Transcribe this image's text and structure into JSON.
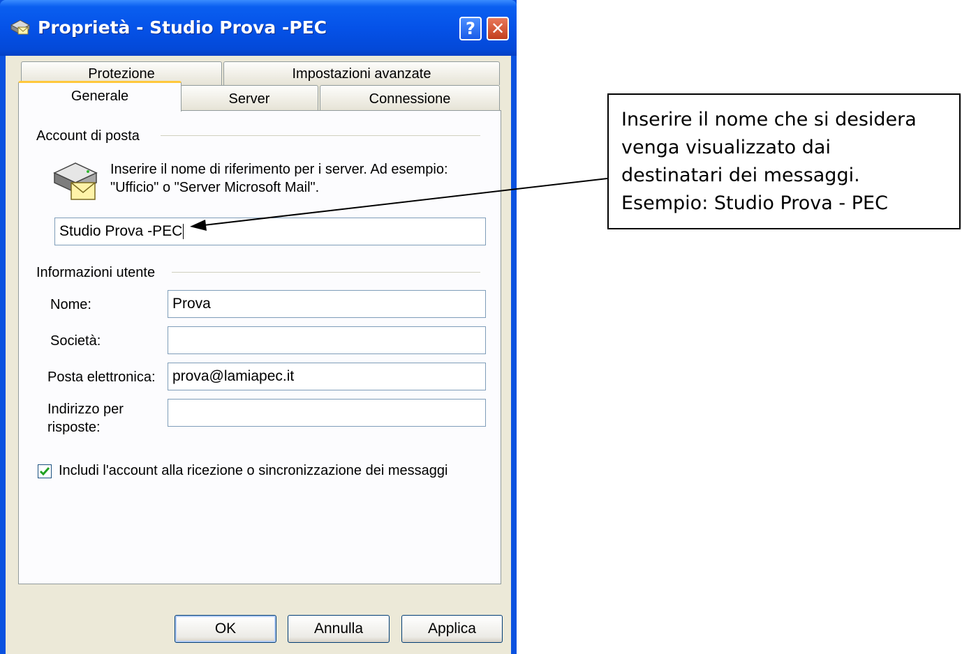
{
  "window": {
    "title": "Proprietà - Studio Prova -PEC",
    "help_label": "?",
    "close_label": "✕"
  },
  "tabs": {
    "protezione": "Protezione",
    "avanzate": "Impostazioni avanzate",
    "generale": "Generale",
    "server": "Server",
    "connessione": "Connessione"
  },
  "account": {
    "group_label": "Account di posta",
    "description_line1": "Inserire il nome di riferimento per i server. Ad esempio:",
    "description_line2": "\"Ufficio\" o \"Server Microsoft Mail\".",
    "name_value": "Studio Prova -PEC"
  },
  "user_info": {
    "group_label": "Informazioni utente",
    "nome_label": "Nome:",
    "nome_value": "Prova",
    "societa_label": "Società:",
    "societa_value": "",
    "email_label": "Posta elettronica:",
    "email_value": "prova@lamiapec.it",
    "reply_label_line1": "Indirizzo per",
    "reply_label_line2": "risposte:",
    "reply_value": ""
  },
  "include_checkbox": {
    "label": "Includi l'account alla ricezione o sincronizzazione dei messaggi",
    "checked": true
  },
  "buttons": {
    "ok": "OK",
    "annulla": "Annulla",
    "applica": "Applica"
  },
  "callout": {
    "line1": "Inserire il nome che si desidera",
    "line2": "venga visualizzato dai",
    "line3": "destinatari dei messaggi.",
    "line4": "Esempio: Studio Prova - PEC"
  },
  "colors": {
    "titlebar": "#0552e8",
    "dialog_bg": "#ece9d8",
    "active_tab_accent": "#ffc83c",
    "field_border": "#7f9db9",
    "check_mark": "#21a121"
  }
}
